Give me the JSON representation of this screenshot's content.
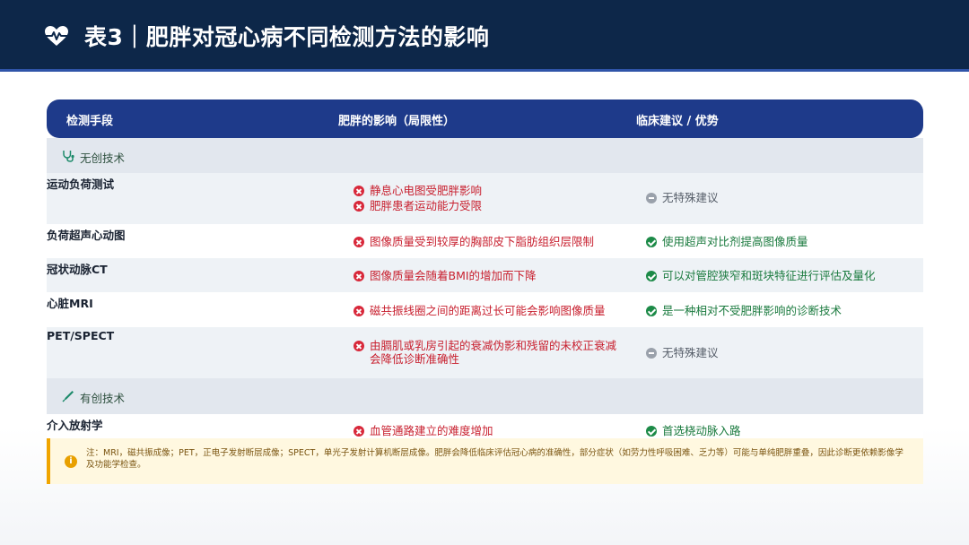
{
  "header": {
    "title": "表3｜肥胖对冠心病不同检测方法的影响",
    "icon": "heart-pulse-icon"
  },
  "table": {
    "columns": [
      "检测手段",
      "肥胖的影响（局限性）",
      "临床建议 / 优势"
    ],
    "sections": [
      {
        "label": "无创技术",
        "icon": "stethoscope-icon",
        "rows": [
          {
            "name": "运动负荷测试",
            "limitations": [
              "静息心电图受肥胖影响",
              "肥胖患者运动能力受限"
            ],
            "advice": {
              "text": "无特殊建议",
              "status": "neutral"
            }
          },
          {
            "name": "负荷超声心动图",
            "limitations": [
              "图像质量受到较厚的胸部皮下脂肪组织层限制"
            ],
            "advice": {
              "text": "使用超声对比剂提高图像质量",
              "status": "positive"
            }
          },
          {
            "name": "冠状动脉CT",
            "limitations": [
              "图像质量会随着BMI的增加而下降"
            ],
            "advice": {
              "text": "可以对管腔狭窄和斑块特征进行评估及量化",
              "status": "positive"
            }
          },
          {
            "name": "心脏MRI",
            "limitations": [
              "磁共振线圈之间的距离过长可能会影响图像质量"
            ],
            "advice": {
              "text": "是一种相对不受肥胖影响的诊断技术",
              "status": "positive"
            }
          },
          {
            "name": "PET/SPECT",
            "limitations": [
              "由膈肌或乳房引起的衰减伪影和残留的未校正衰减",
              "会降低诊断准确性"
            ],
            "advice": {
              "text": "无特殊建议",
              "status": "neutral"
            }
          }
        ]
      },
      {
        "label": "有创技术",
        "icon": "syringe-icon",
        "rows": [
          {
            "name": "介入放射学",
            "limitations": [
              "血管通路建立的难度增加"
            ],
            "advice": {
              "text": "首选桡动脉入路",
              "status": "positive"
            }
          }
        ]
      }
    ]
  },
  "note": "注：MRI，磁共振成像；PET，正电子发射断层成像；SPECT，单光子发射计算机断层成像。肥胖会降低临床评估冠心病的准确性，部分症状（如劳力性呼吸困难、乏力等）可能与单纯肥胖重叠，因此诊断更依赖影像学及功能学检查。",
  "colors": {
    "header_bg": "#0d2749",
    "table_header_bg": "#1e3a8a",
    "negative": "#d8283a",
    "positive": "#1c8a47",
    "neutral": "#9aa1ab",
    "note_accent": "#f0a500"
  }
}
